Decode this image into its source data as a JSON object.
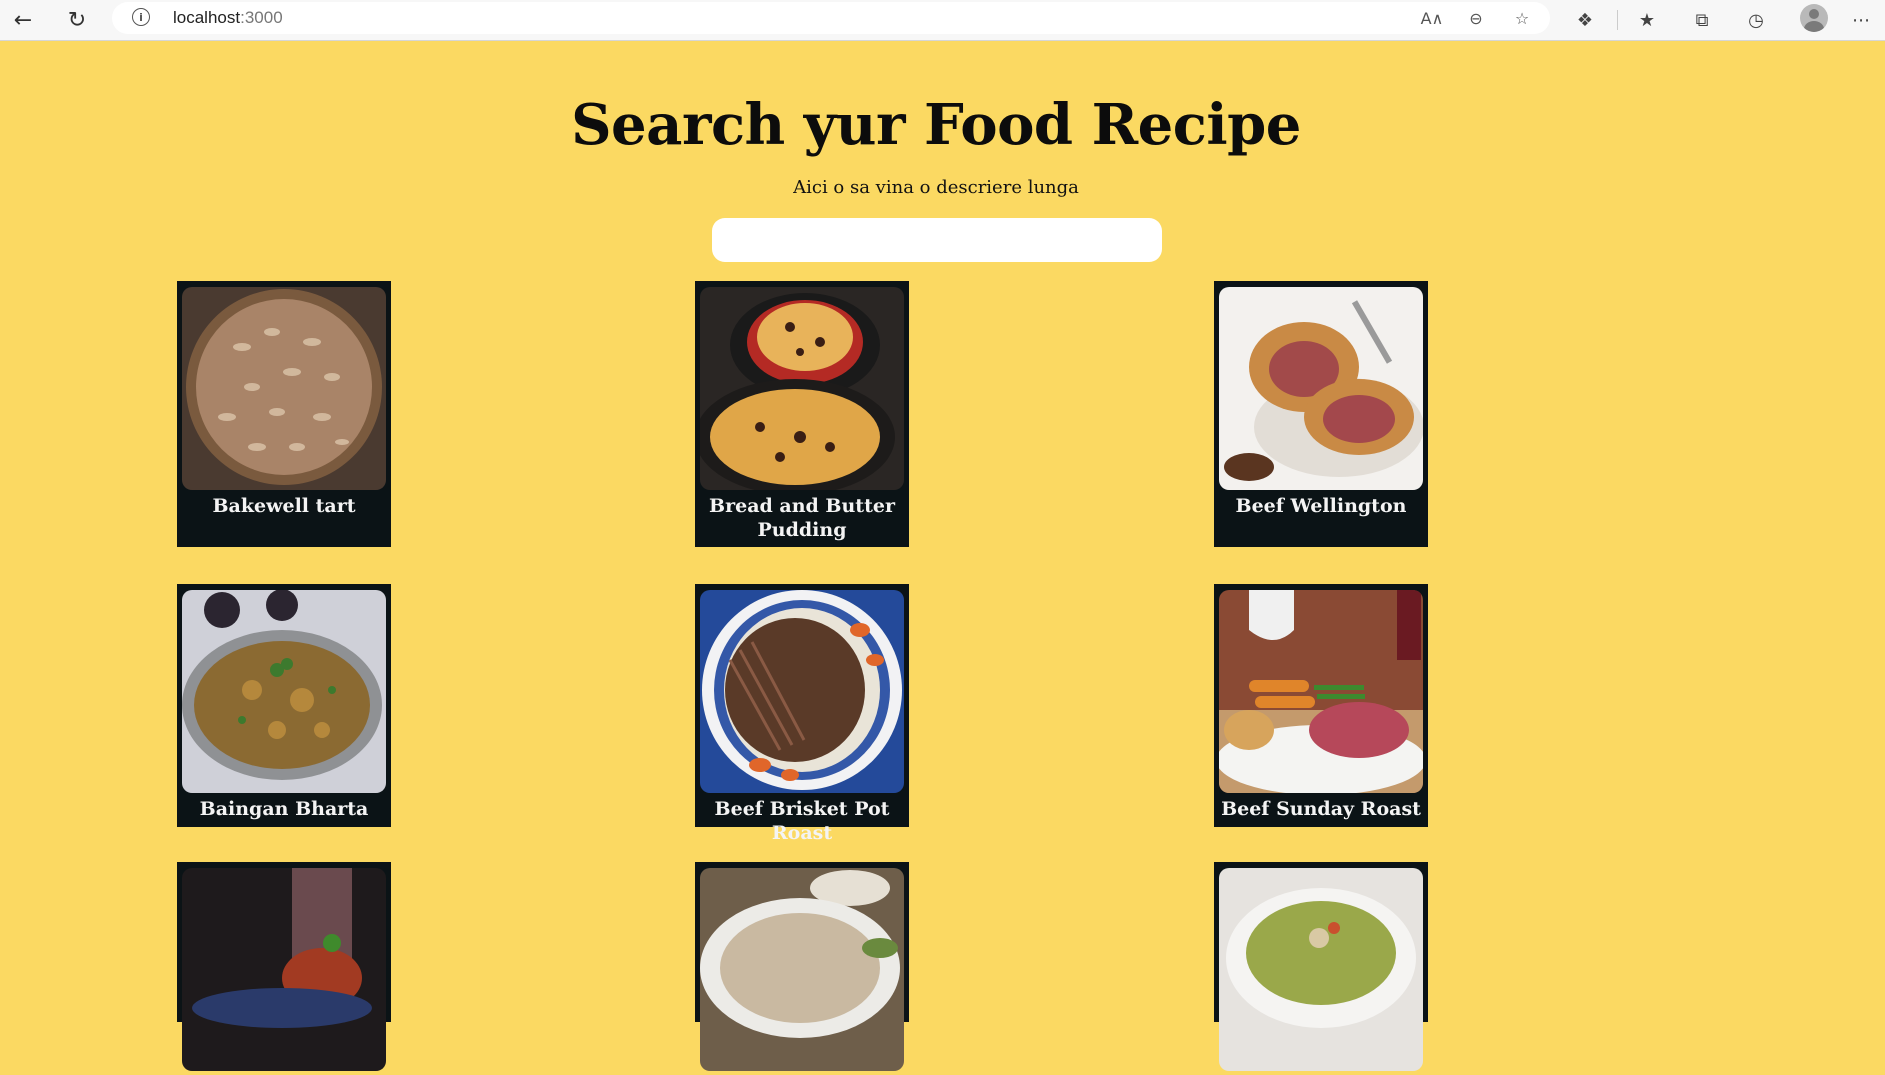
{
  "browser": {
    "url_host": "localhost",
    "url_port": ":3000",
    "icons": [
      "back-icon",
      "refresh-icon",
      "site-info-icon",
      "read-aloud-icon",
      "zoom-out-icon",
      "add-favorite-icon",
      "extensions-icon",
      "favorites-icon",
      "collections-icon",
      "history-icon",
      "profile-icon",
      "more-icon"
    ]
  },
  "page": {
    "title": "Search yur Food Recipe",
    "subtitle": "Aici o sa vina o descriere lunga",
    "search": {
      "value": "",
      "placeholder": ""
    }
  },
  "recipes": [
    {
      "name": "Bakewell tart"
    },
    {
      "name": "Bread and Butter Pudding"
    },
    {
      "name": "Beef Wellington"
    },
    {
      "name": "Baingan Bharta"
    },
    {
      "name": "Beef Brisket Pot Roast"
    },
    {
      "name": "Beef Sunday Roast"
    },
    {
      "name": ""
    },
    {
      "name": ""
    },
    {
      "name": ""
    }
  ],
  "colors": {
    "background": "#fbd962",
    "card": "#0b1316",
    "title": "#0c0c0c"
  }
}
